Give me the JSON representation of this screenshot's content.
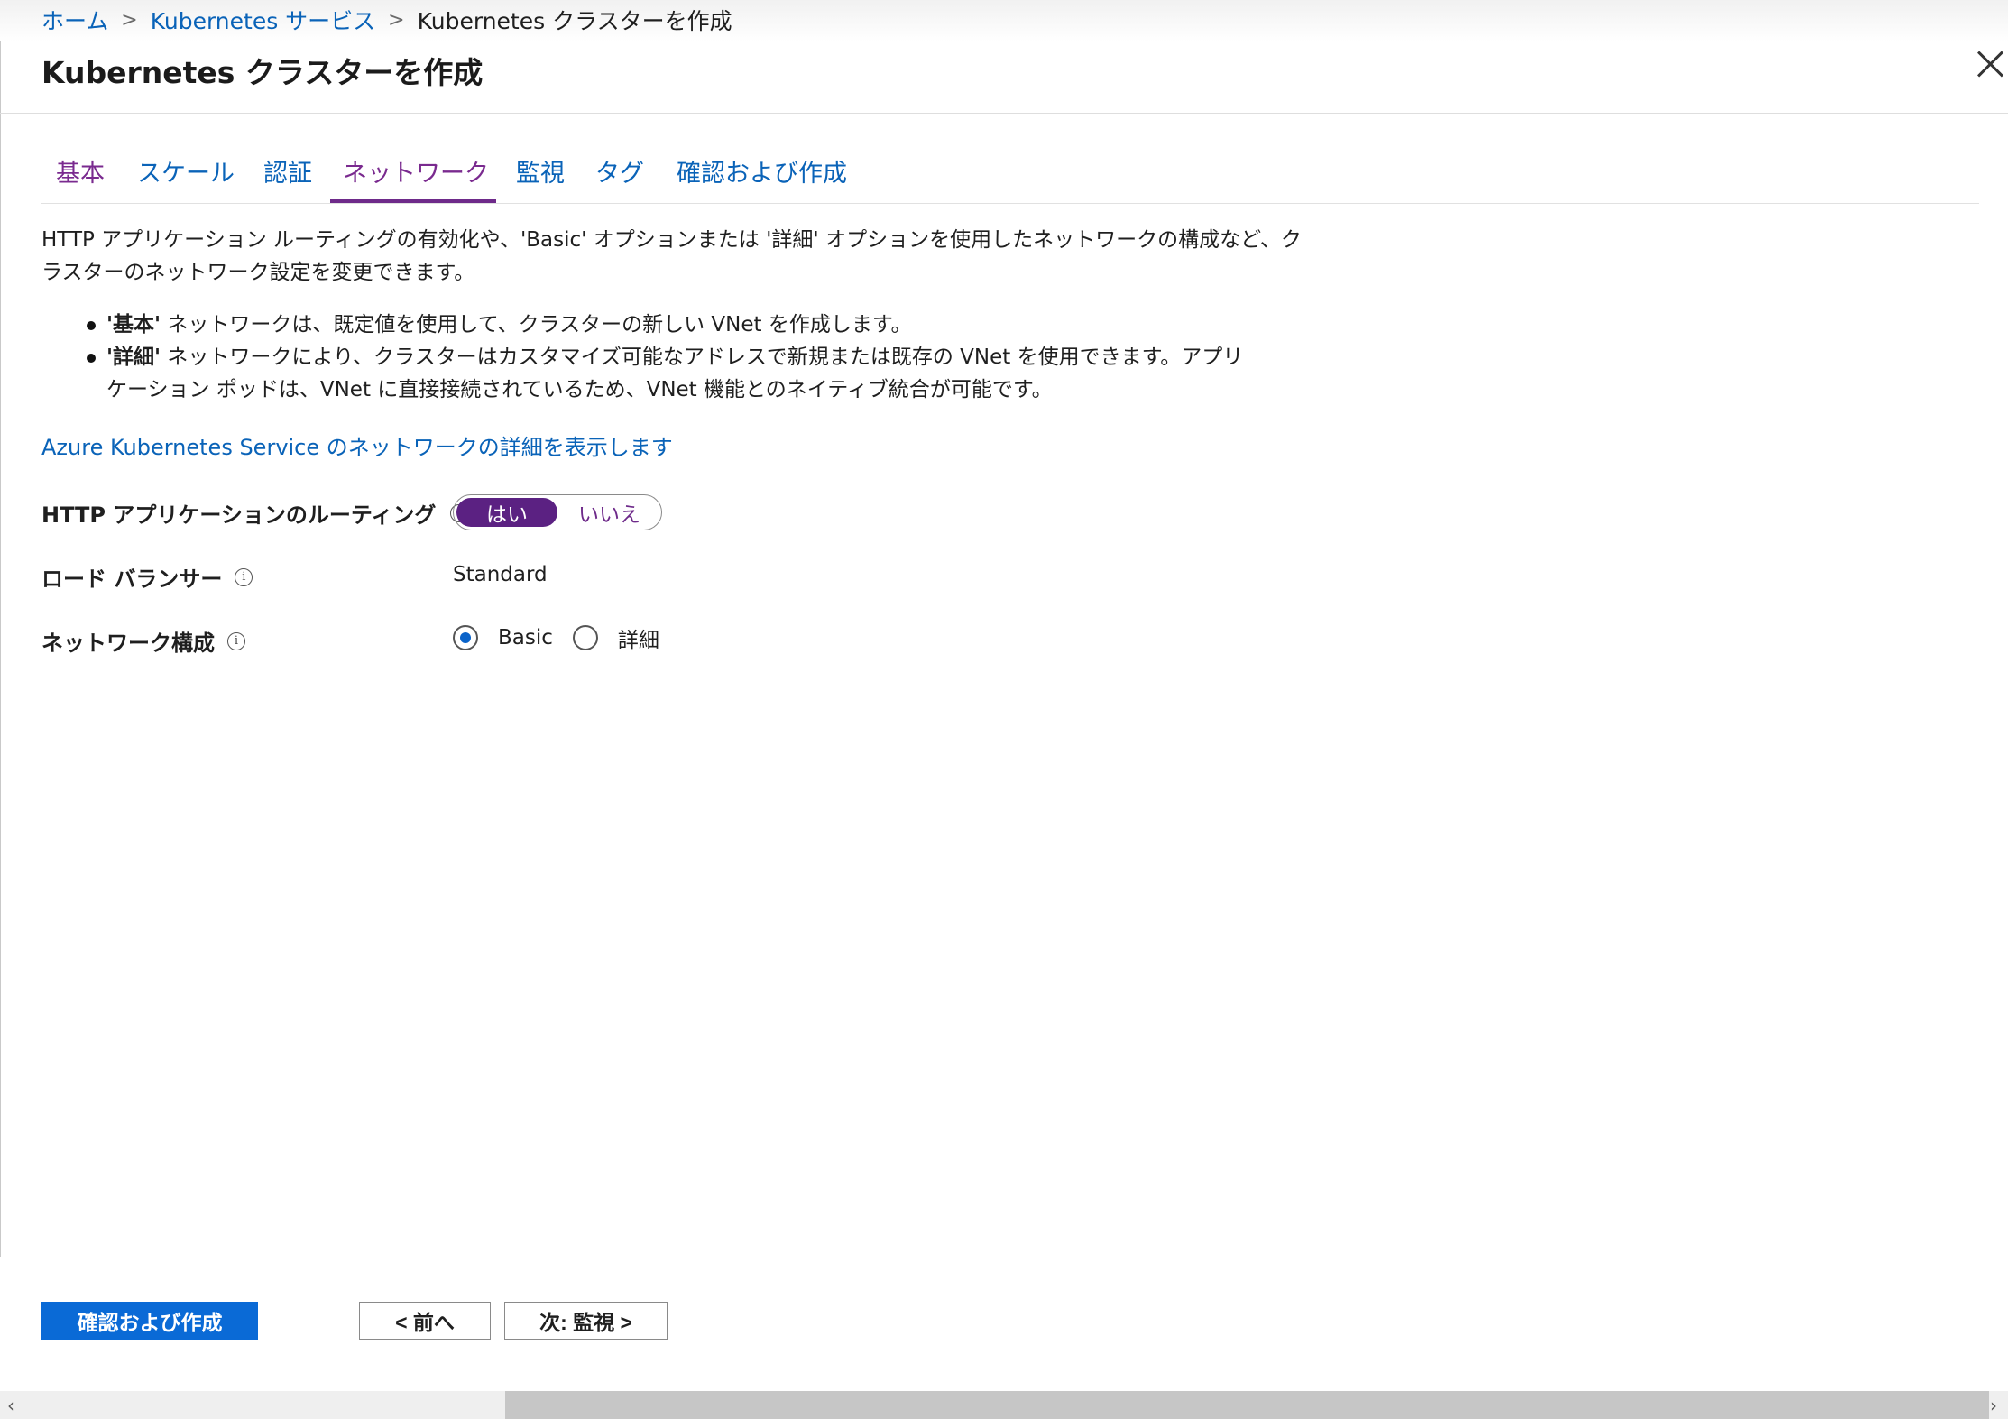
{
  "breadcrumb": {
    "items": [
      "ホーム",
      "Kubernetes サービス",
      "Kubernetes クラスターを作成"
    ]
  },
  "panel": {
    "title": "Kubernetes クラスターを作成"
  },
  "tabs": [
    {
      "label": "基本"
    },
    {
      "label": "スケール"
    },
    {
      "label": "認証"
    },
    {
      "label": "ネットワーク"
    },
    {
      "label": "監視"
    },
    {
      "label": "タグ"
    },
    {
      "label": "確認および作成"
    }
  ],
  "content": {
    "description": "HTTP アプリケーション ルーティングの有効化や、'Basic' オプションまたは '詳細' オプションを使用したネットワークの構成など、クラスターのネットワーク設定を変更できます。",
    "bullet1_bold": "'基本'",
    "bullet1_text": " ネットワークは、既定値を使用して、クラスターの新しい VNet を作成します。",
    "bullet2_bold": "'詳細'",
    "bullet2_text": " ネットワークにより、クラスターはカスタマイズ可能なアドレスで新規または既存の VNet を使用できます。アプリケーション ポッドは、VNet に直接接続されているため、VNet 機能とのネイティブ統合が可能です。",
    "learn_more_link": "Azure Kubernetes Service のネットワークの詳細を表示します"
  },
  "form": {
    "http_routing": {
      "label": "HTTP アプリケーションのルーティング",
      "yes": "はい",
      "no": "いいえ"
    },
    "load_balancer": {
      "label": "ロード バランサー",
      "value": "Standard"
    },
    "network_config": {
      "label": "ネットワーク構成",
      "option_basic": "Basic",
      "option_advanced": "詳細"
    }
  },
  "footer": {
    "review_create": "確認および作成",
    "previous": "< 前へ",
    "next": "次: 監視 >"
  },
  "scrollbar": {
    "left_arrow": "‹",
    "right_arrow": "›"
  },
  "info_glyph": "i"
}
